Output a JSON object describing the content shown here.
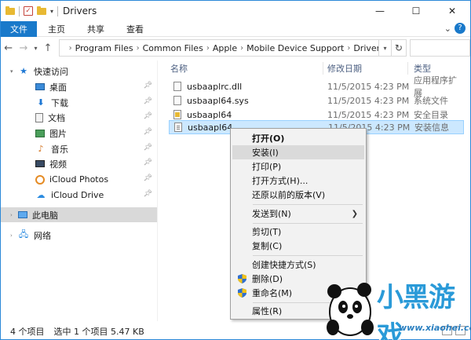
{
  "window": {
    "title": "Drivers",
    "controls": {
      "minimize": "—",
      "maximize": "☐",
      "close": "✕"
    }
  },
  "ribbon": {
    "tabs": [
      "文件",
      "主页",
      "共享",
      "查看"
    ]
  },
  "address": {
    "crumbs": [
      "Program Files",
      "Common Files",
      "Apple",
      "Mobile Device Support",
      "Drivers"
    ]
  },
  "nav": {
    "quick_access": "快速访问",
    "items": [
      {
        "label": "桌面",
        "icon": "desktop-icon",
        "pinned": true
      },
      {
        "label": "下载",
        "icon": "download-icon",
        "pinned": true
      },
      {
        "label": "文档",
        "icon": "document-icon",
        "pinned": true
      },
      {
        "label": "图片",
        "icon": "pictures-icon",
        "pinned": true
      },
      {
        "label": "音乐",
        "icon": "music-icon",
        "pinned": true
      },
      {
        "label": "视频",
        "icon": "video-icon",
        "pinned": true
      },
      {
        "label": "iCloud Photos",
        "icon": "icloud-photos-icon",
        "pinned": true
      },
      {
        "label": "iCloud Drive",
        "icon": "icloud-drive-icon",
        "pinned": true
      }
    ],
    "this_pc": "此电脑",
    "network": "网络"
  },
  "columns": {
    "name": "名称",
    "date": "修改日期",
    "type": "类型"
  },
  "files": [
    {
      "name": "usbaaplrc.dll",
      "date": "11/5/2015 4:23 PM",
      "type": "应用程序扩展",
      "icon": "dll-file-icon"
    },
    {
      "name": "usbaapl64.sys",
      "date": "11/5/2015 4:23 PM",
      "type": "系统文件",
      "icon": "sys-file-icon"
    },
    {
      "name": "usbaapl64",
      "date": "11/5/2015 4:23 PM",
      "type": "安全目录",
      "icon": "catalog-file-icon"
    },
    {
      "name": "usbaapl64",
      "date": "11/5/2015 4:23 PM",
      "type": "安装信息",
      "icon": "inf-file-icon",
      "selected": true
    }
  ],
  "status": {
    "count": "4 个项目",
    "selection": "选中 1 个项目  5.47 KB"
  },
  "context_menu": {
    "items": [
      {
        "label": "打开(O)",
        "bold": true
      },
      {
        "label": "安装(I)",
        "highlight": true
      },
      {
        "label": "打印(P)"
      },
      {
        "label": "打开方式(H)..."
      },
      {
        "label": "还原以前的版本(V)"
      },
      {
        "label": "发送到(N)",
        "submenu": true
      },
      {
        "label": "剪切(T)"
      },
      {
        "label": "复制(C)"
      },
      {
        "label": "创建快捷方式(S)"
      },
      {
        "label": "删除(D)",
        "shield": true
      },
      {
        "label": "重命名(M)",
        "shield": true
      },
      {
        "label": "属性(R)"
      }
    ]
  },
  "watermark": {
    "brand": "小黑游戏",
    "site": "www.xiaohei.com"
  }
}
